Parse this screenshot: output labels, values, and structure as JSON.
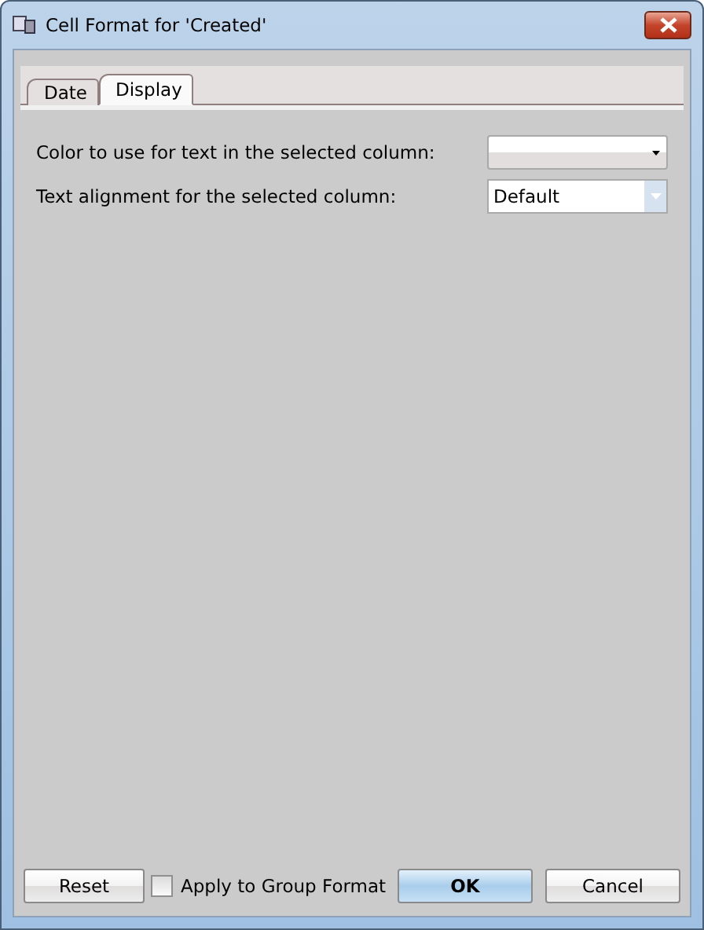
{
  "window": {
    "title": "Cell Format for 'Created'"
  },
  "tabs": [
    {
      "label": "Date",
      "selected": false
    },
    {
      "label": "Display",
      "selected": true
    }
  ],
  "fields": [
    {
      "label": "Color to use for text in the selected column:",
      "kind": "color"
    },
    {
      "label": "Text alignment for the selected column:",
      "kind": "select",
      "value": "Default"
    }
  ],
  "footer": {
    "reset": "Reset",
    "apply_group": {
      "label": "Apply to Group Format",
      "checked": false
    },
    "ok": "OK",
    "cancel": "Cancel"
  }
}
